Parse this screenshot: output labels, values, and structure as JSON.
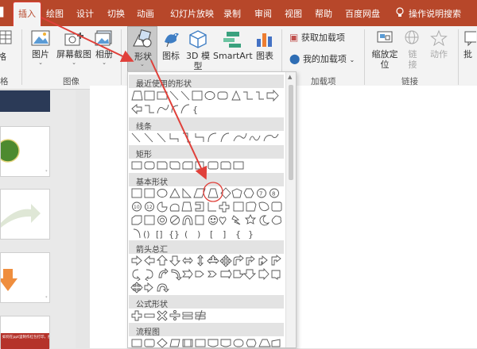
{
  "tabs": [
    "插入",
    "绘图",
    "设计",
    "切换",
    "动画",
    "幻灯片放映",
    "录制",
    "审阅",
    "视图",
    "帮助",
    "百度网盘",
    "操作说明搜索"
  ],
  "ribbon": {
    "table_partial": "表格",
    "picture": "图片",
    "screenshot": "屏幕截图",
    "album": "相册",
    "shapes": "形状",
    "icons": "图标",
    "model3d_line1": "3D 模",
    "model3d_line2": "型",
    "smartart": "SmartArt",
    "chart": "图表",
    "get_addins": "获取加载项",
    "my_addins": "我的加载项",
    "zoom_line1": "缩放定",
    "zoom_line2": "位",
    "link_line1": "链",
    "link_line2": "接",
    "action": "动作",
    "insert_partial": "批"
  },
  "groups": {
    "tables_partial": "格",
    "images": "图像",
    "addins": "加载项",
    "links": "链接"
  },
  "slides": {
    "s3_caption": "如何在ppt里制作红包打印，那么这样操作"
  },
  "menu": {
    "sections": [
      "最近使用的形状",
      "线条",
      "矩形",
      "基本形状",
      "箭头总汇",
      "公式形状",
      "流程图"
    ]
  },
  "colors": {
    "accent": "#b7472a",
    "annotation": "#e0403a",
    "ribbon_bg": "#f3f3f3"
  }
}
